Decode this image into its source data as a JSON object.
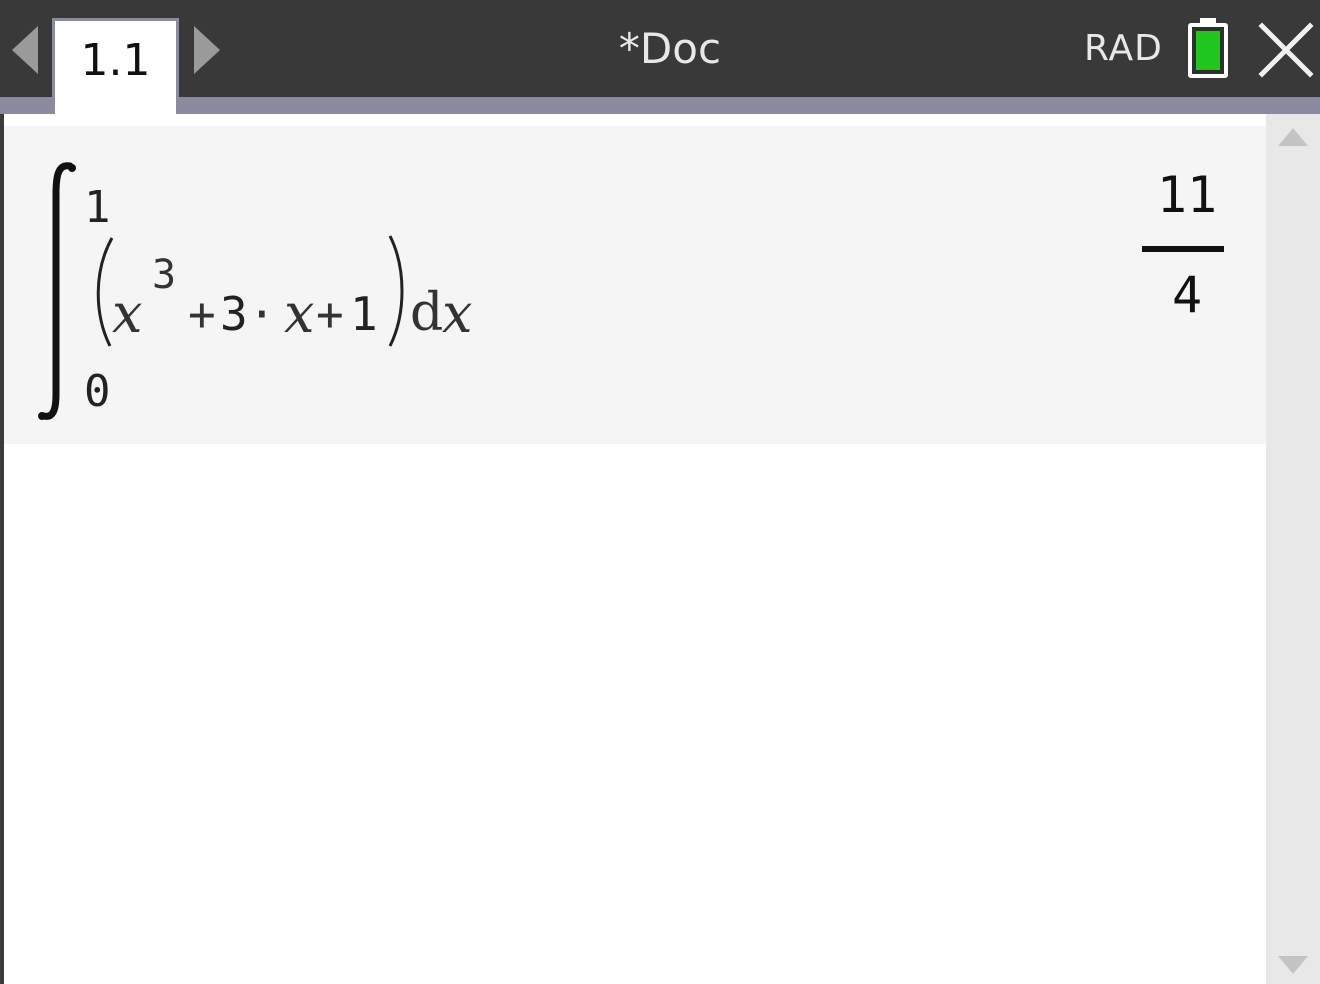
{
  "topbar": {
    "page_tab": "1.1",
    "doc_title": "*Doc",
    "angle_mode": "RAD",
    "battery_color": "#1ec81e"
  },
  "icons": {
    "prev": "triangle-left-icon",
    "next": "triangle-right-icon",
    "battery": "battery-icon",
    "close": "close-x-icon",
    "scroll_up": "triangle-up-icon",
    "scroll_down": "triangle-down-icon"
  },
  "calculator": {
    "entry": {
      "upper_limit": "1",
      "lower_limit": "0",
      "base_var": "x",
      "exponent": "3",
      "term_plus_1": "+",
      "coefficient": "3",
      "dot": "·",
      "term_var": "x",
      "term_plus_2": "+",
      "constant": "1",
      "differential_d": "d",
      "differential_var": "x"
    },
    "result": {
      "numerator": "11",
      "denominator": "4"
    }
  }
}
